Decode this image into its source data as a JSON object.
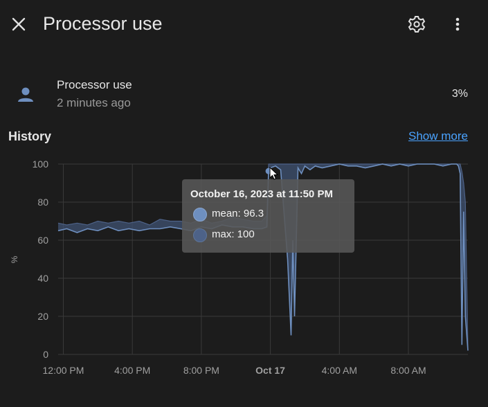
{
  "header": {
    "title": "Processor use",
    "close_icon": "close-icon",
    "settings_icon": "gear-icon",
    "menu_icon": "more-vertical-icon"
  },
  "entity": {
    "icon": "account-icon",
    "name": "Processor use",
    "last_changed": "2 minutes ago",
    "value": "3%"
  },
  "history": {
    "label": "History",
    "show_more": "Show more"
  },
  "tooltip": {
    "title": "October 16, 2023 at 11:50 PM",
    "mean_label": "mean: 96.3",
    "max_label": "max: 100"
  },
  "colors": {
    "background": "#1c1c1c",
    "line": "#6e8fbf",
    "band": "#3f5272",
    "link": "#4aa3ff"
  },
  "chart_data": {
    "type": "line",
    "ylabel": "%",
    "ylim": [
      0,
      100
    ],
    "yticks": [
      0,
      20,
      40,
      60,
      80,
      100
    ],
    "xlim": [
      11.7,
      35.45
    ],
    "xticks": [
      {
        "v": 12,
        "label": "12:00 PM",
        "bold": false
      },
      {
        "v": 16,
        "label": "4:00 PM",
        "bold": false
      },
      {
        "v": 20,
        "label": "8:00 PM",
        "bold": false
      },
      {
        "v": 24,
        "label": "Oct 17",
        "bold": true
      },
      {
        "v": 28,
        "label": "4:00 AM",
        "bold": false
      },
      {
        "v": 32,
        "label": "8:00 AM",
        "bold": false
      }
    ],
    "grid": true,
    "series": [
      {
        "stat": "max",
        "x": [
          11.7,
          12.2,
          12.8,
          13.4,
          14.0,
          14.6,
          15.2,
          15.8,
          16.4,
          17.0,
          17.6,
          18.2,
          18.8,
          19.4,
          20.0,
          20.6,
          21.2,
          21.8,
          22.4,
          23.0,
          23.5,
          23.8,
          23.9,
          24.0,
          24.3,
          24.6,
          25.0,
          25.2,
          25.3,
          25.4,
          25.6,
          25.8,
          26.0,
          26.3,
          26.6,
          27.0,
          27.5,
          28.0,
          28.5,
          29.0,
          29.5,
          30.0,
          30.5,
          31.0,
          31.5,
          32.0,
          32.5,
          33.0,
          33.5,
          34.0,
          34.5,
          34.8,
          34.9,
          35.0,
          35.1,
          35.2,
          35.3,
          35.45
        ],
        "values": [
          69,
          68,
          69,
          68,
          70,
          69,
          70,
          69,
          70,
          68,
          71,
          70,
          70,
          69,
          71,
          69,
          70,
          72,
          71,
          70,
          70,
          73,
          100,
          100,
          100,
          100,
          100,
          100,
          100,
          100,
          100,
          100,
          100,
          100,
          100,
          100,
          100,
          100,
          100,
          100,
          100,
          100,
          100,
          100,
          100,
          100,
          100,
          100,
          100,
          100,
          100,
          100,
          100,
          100,
          96,
          90,
          80,
          3
        ]
      },
      {
        "stat": "mean",
        "x": [
          11.7,
          12.2,
          12.8,
          13.4,
          14.0,
          14.6,
          15.2,
          15.8,
          16.4,
          17.0,
          17.6,
          18.2,
          18.8,
          19.4,
          20.0,
          20.6,
          21.2,
          21.8,
          22.4,
          23.0,
          23.5,
          23.8,
          23.9,
          24.0,
          24.3,
          24.6,
          25.0,
          25.2,
          25.3,
          25.4,
          25.6,
          25.8,
          26.0,
          26.3,
          26.6,
          27.0,
          27.5,
          28.0,
          28.5,
          29.0,
          29.5,
          30.0,
          30.5,
          31.0,
          31.5,
          32.0,
          32.5,
          33.0,
          33.5,
          34.0,
          34.5,
          34.8,
          34.9,
          35.0,
          35.1,
          35.2,
          35.3,
          35.45
        ],
        "values": [
          65,
          66,
          64,
          66,
          65,
          67,
          65,
          66,
          65,
          66,
          66,
          67,
          66,
          65,
          67,
          66,
          68,
          67,
          67,
          66,
          66,
          67,
          96.3,
          98,
          99,
          97,
          50,
          10,
          60,
          20,
          98,
          95,
          99,
          97,
          99,
          98,
          99,
          100,
          99,
          99,
          98,
          99,
          100,
          99,
          100,
          99,
          100,
          100,
          100,
          99,
          100,
          100,
          99,
          95,
          5,
          75,
          20,
          2
        ]
      }
    ]
  }
}
